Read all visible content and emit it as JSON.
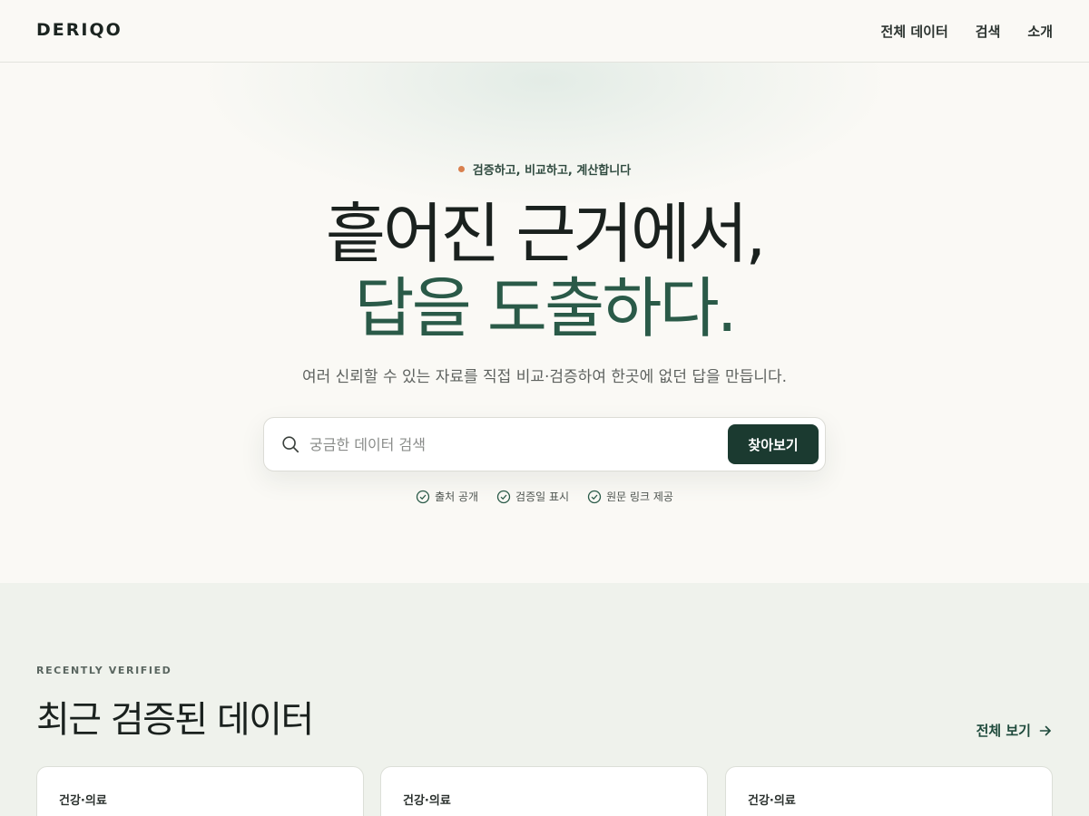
{
  "header": {
    "logo": "DERIQO",
    "nav": [
      "전체 데이터",
      "검색",
      "소개"
    ]
  },
  "hero": {
    "tagline": "검증하고, 비교하고, 계산합니다",
    "headline_line1": "흩어진 근거에서,",
    "headline_line2": "답을 도출하다.",
    "subcopy": "여러 신뢰할 수 있는 자료를 직접 비교·검증하여 한곳에 없던 답을 만듭니다.",
    "search": {
      "placeholder": "궁금한 데이터 검색",
      "button": "찾아보기"
    },
    "features": [
      "출처 공개",
      "검증일 표시",
      "원문 링크 제공"
    ]
  },
  "recent": {
    "eyebrow": "RECENTLY VERIFIED",
    "title": "최근 검증된 데이터",
    "view_all": "전체 보기",
    "cards": [
      {
        "category": "건강·의료"
      },
      {
        "category": "건강·의료"
      },
      {
        "category": "건강·의료"
      }
    ]
  },
  "colors": {
    "accent_dark": "#1b3a30",
    "accent_green": "#2a5a48",
    "dot_orange": "#d9804e",
    "background": "#faf9f5",
    "section_background": "#eff2ec"
  }
}
